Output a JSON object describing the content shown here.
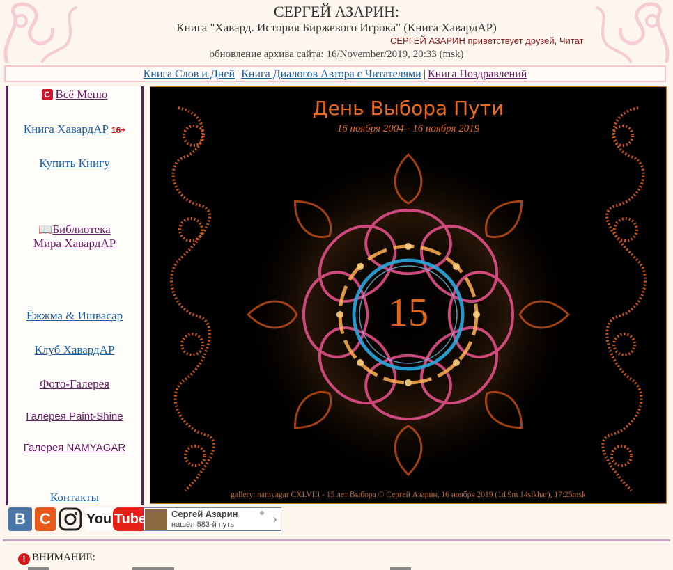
{
  "header": {
    "site_title": "СЕРГЕЙ АЗАРИН:",
    "book_title": "Книга \"Хавард. История Биржевого Игрока\" (Книга ХавардАР)",
    "ticker": "СЕРГЕЙ АЗАРИН приветствует друзей, Читат",
    "updated": "обновление архива сайта: 16/November/2019, 20:33 (msk)"
  },
  "topnav": {
    "items": [
      "Книга Слов и Дней",
      "Книга Диалогов Автора с Читателями",
      "Книга Поздравлений"
    ],
    "separator": "|"
  },
  "sidebar": {
    "menu": "Всё Меню",
    "book_havardar": "Книга ХавардАР",
    "age_badge": "16+",
    "buy_book": "Купить Книгу",
    "library_line1": "Библиотека",
    "library_line2": "Мира ХавардАР",
    "ezhma": "Ёжжма & Ишвасар",
    "club": "Клуб ХавардАР",
    "photo_gallery": "Фото-Галерея",
    "gallery_paint": "Галерея Paint-Shine",
    "gallery_namyagar": "Галерея NAMYAGAR",
    "contacts": "Контакты"
  },
  "gallery": {
    "title": "День Выбора Пути",
    "dates": "16 ноября 2004 - 16 ноября 2019",
    "number": "15",
    "caption": "gallery: namyagar CXLVIII - 15 лет Выбора © Сергей Азарин, 16 ноября 2019 (1d 9m 14sikhar), 17:25msk"
  },
  "social": {
    "vk_label": "B",
    "cz_label": "C",
    "youtube_you": "You",
    "youtube_tube": "Tube",
    "profile_name": "Сергей Азарин",
    "profile_status": "нашёл 583-й путь",
    "chevron": "›"
  },
  "footer": {
    "attention": "ВНИМАНИЕ:"
  },
  "colors": {
    "accent_orange": "#e96a1e",
    "link": "#1a5fa8",
    "visited": "#6a1a6a",
    "sidebar_border": "#5a1d5a"
  }
}
